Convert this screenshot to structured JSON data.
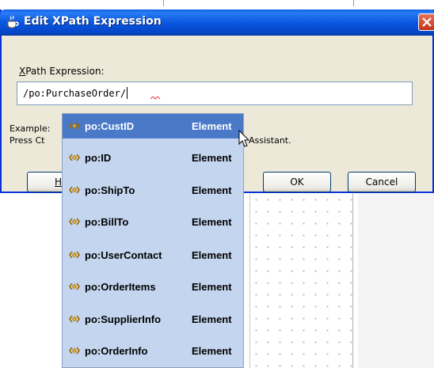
{
  "dialog": {
    "title": "Edit XPath Expression",
    "field_label_accel": "X",
    "field_label_rest": "Path Expression:",
    "input_value": "/po:PurchaseOrder/",
    "example_text": "Example: ",
    "press_text": "Press Ct",
    "press_tail": "Assistant.",
    "help_button_accel": "H",
    "ok_button": "OK",
    "cancel_button": "Cancel"
  },
  "autocomplete": {
    "items": [
      {
        "name": "po:CustID",
        "kind": "Element",
        "selected": true
      },
      {
        "name": "po:ID",
        "kind": "Element"
      },
      {
        "name": "po:ShipTo",
        "kind": "Element"
      },
      {
        "name": "po:BillTo",
        "kind": "Element"
      },
      {
        "name": "po:UserContact",
        "kind": "Element"
      },
      {
        "name": "po:OrderItems",
        "kind": "Element"
      },
      {
        "name": "po:SupplierInfo",
        "kind": "Element"
      },
      {
        "name": "po:OrderInfo",
        "kind": "Element"
      }
    ],
    "item_icon": "xml-element-icon"
  },
  "colors": {
    "titlebar": "#0a58e0",
    "selected_item": "#4a79c8",
    "popup_background": "#c4d5ef",
    "dialog_background": "#ece9d8"
  }
}
